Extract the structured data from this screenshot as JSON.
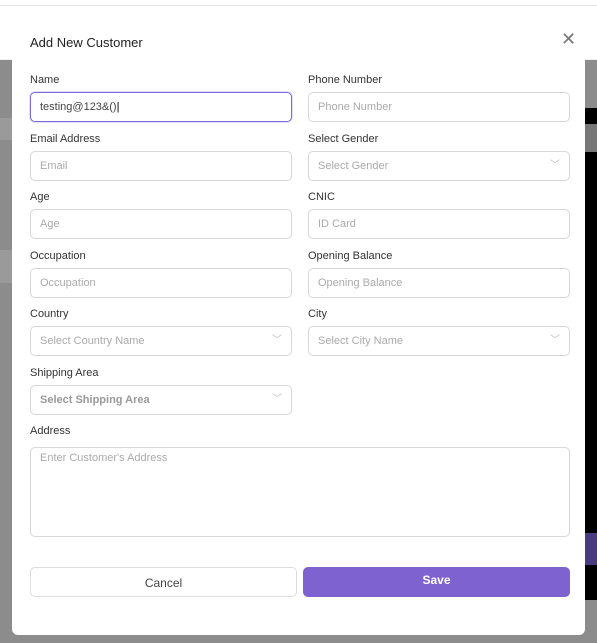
{
  "modal": {
    "title": "Add New Customer"
  },
  "fields": {
    "name": {
      "label": "Name",
      "value": "testing@123&()"
    },
    "phone": {
      "label": "Phone Number",
      "placeholder": "Phone Number"
    },
    "email": {
      "label": "Email Address",
      "placeholder": "Email"
    },
    "gender": {
      "label": "Select Gender",
      "placeholder": "Select Gender"
    },
    "age": {
      "label": "Age",
      "placeholder": "Age"
    },
    "cnic": {
      "label": "CNIC",
      "placeholder": "ID Card"
    },
    "occupation": {
      "label": "Occupation",
      "placeholder": "Occupation"
    },
    "opening_balance": {
      "label": "Opening Balance",
      "placeholder": "Opening Balance"
    },
    "country": {
      "label": "Country",
      "placeholder": "Select Country Name"
    },
    "city": {
      "label": "City",
      "placeholder": "Select City Name"
    },
    "shipping_area": {
      "label": "Shipping Area",
      "placeholder": "Select Shipping Area"
    },
    "address": {
      "label": "Address",
      "placeholder": "Enter Customer's Address"
    }
  },
  "buttons": {
    "cancel": "Cancel",
    "save": "Save"
  },
  "colors": {
    "accent": "#7e63d0"
  }
}
